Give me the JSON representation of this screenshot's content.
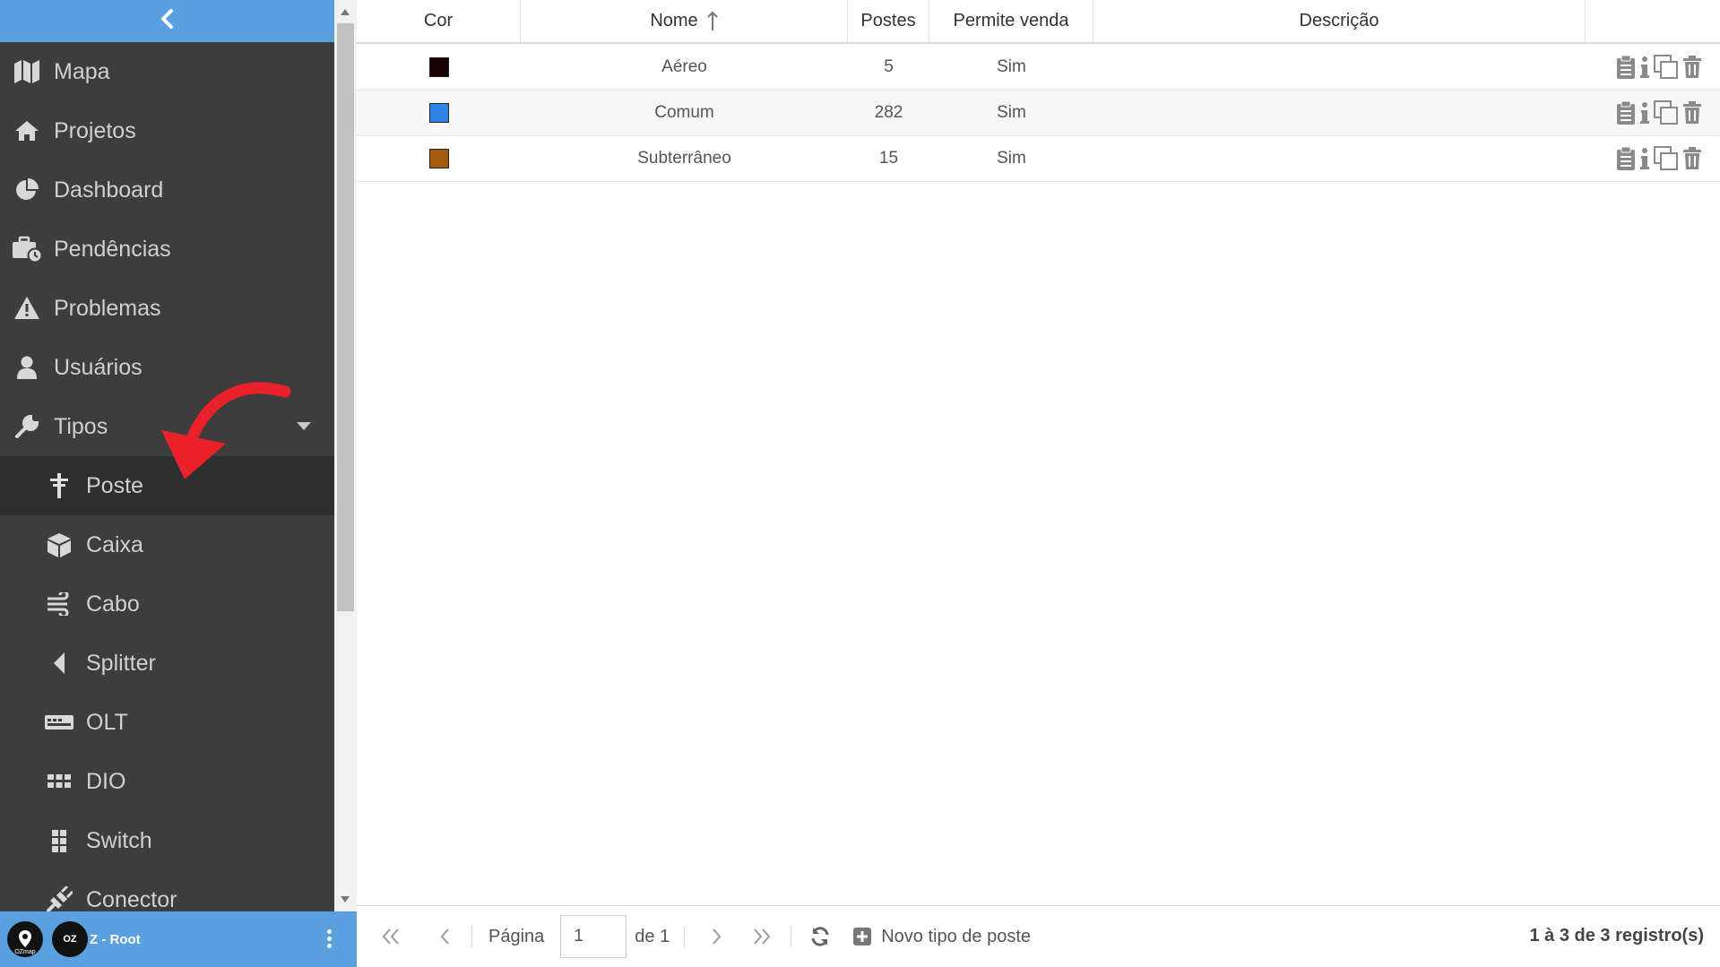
{
  "sidebar": {
    "items": [
      {
        "label": "Mapa",
        "icon": "map-icon"
      },
      {
        "label": "Projetos",
        "icon": "home-icon"
      },
      {
        "label": "Dashboard",
        "icon": "pie-chart-icon"
      },
      {
        "label": "Pendências",
        "icon": "briefcase-clock-icon"
      },
      {
        "label": "Problemas",
        "icon": "warning-icon"
      },
      {
        "label": "Usuários",
        "icon": "user-icon"
      },
      {
        "label": "Tipos",
        "icon": "wrench-icon"
      }
    ],
    "subitems": [
      {
        "label": "Poste",
        "icon": "pole-icon"
      },
      {
        "label": "Caixa",
        "icon": "cube-icon"
      },
      {
        "label": "Cabo",
        "icon": "cable-icon"
      },
      {
        "label": "Splitter",
        "icon": "splitter-icon"
      },
      {
        "label": "OLT",
        "icon": "olt-icon"
      },
      {
        "label": "DIO",
        "icon": "dio-grid-icon"
      },
      {
        "label": "Switch",
        "icon": "switch-grid-icon"
      },
      {
        "label": "Conector",
        "icon": "plug-icon"
      }
    ],
    "active_item": "Poste"
  },
  "user_bar": {
    "name": "Z - Root",
    "logo_text": "OZmap",
    "avatar_text": "OZ"
  },
  "table": {
    "headers": {
      "cor": "Cor",
      "nome": "Nome",
      "postes": "Postes",
      "permite_venda": "Permite venda",
      "descricao": "Descrição"
    },
    "rows": [
      {
        "color": "#1a0000",
        "nome": "Aéreo",
        "postes": "5",
        "permite_venda": "Sim",
        "descricao": ""
      },
      {
        "color": "#2f86e8",
        "nome": "Comum",
        "postes": "282",
        "permite_venda": "Sim",
        "descricao": ""
      },
      {
        "color": "#a4590c",
        "nome": "Subterrâneo",
        "postes": "15",
        "permite_venda": "Sim",
        "descricao": ""
      }
    ]
  },
  "pager": {
    "page_label": "Página",
    "page_value": "1",
    "of_label": "de 1",
    "new_label": "Novo tipo de poste",
    "records": "1 à 3 de 3 registro(s)"
  },
  "colors": {
    "accent": "#5a9fde",
    "sidebar_bg": "#3d3d3d",
    "annotation_arrow": "#e8212a"
  }
}
